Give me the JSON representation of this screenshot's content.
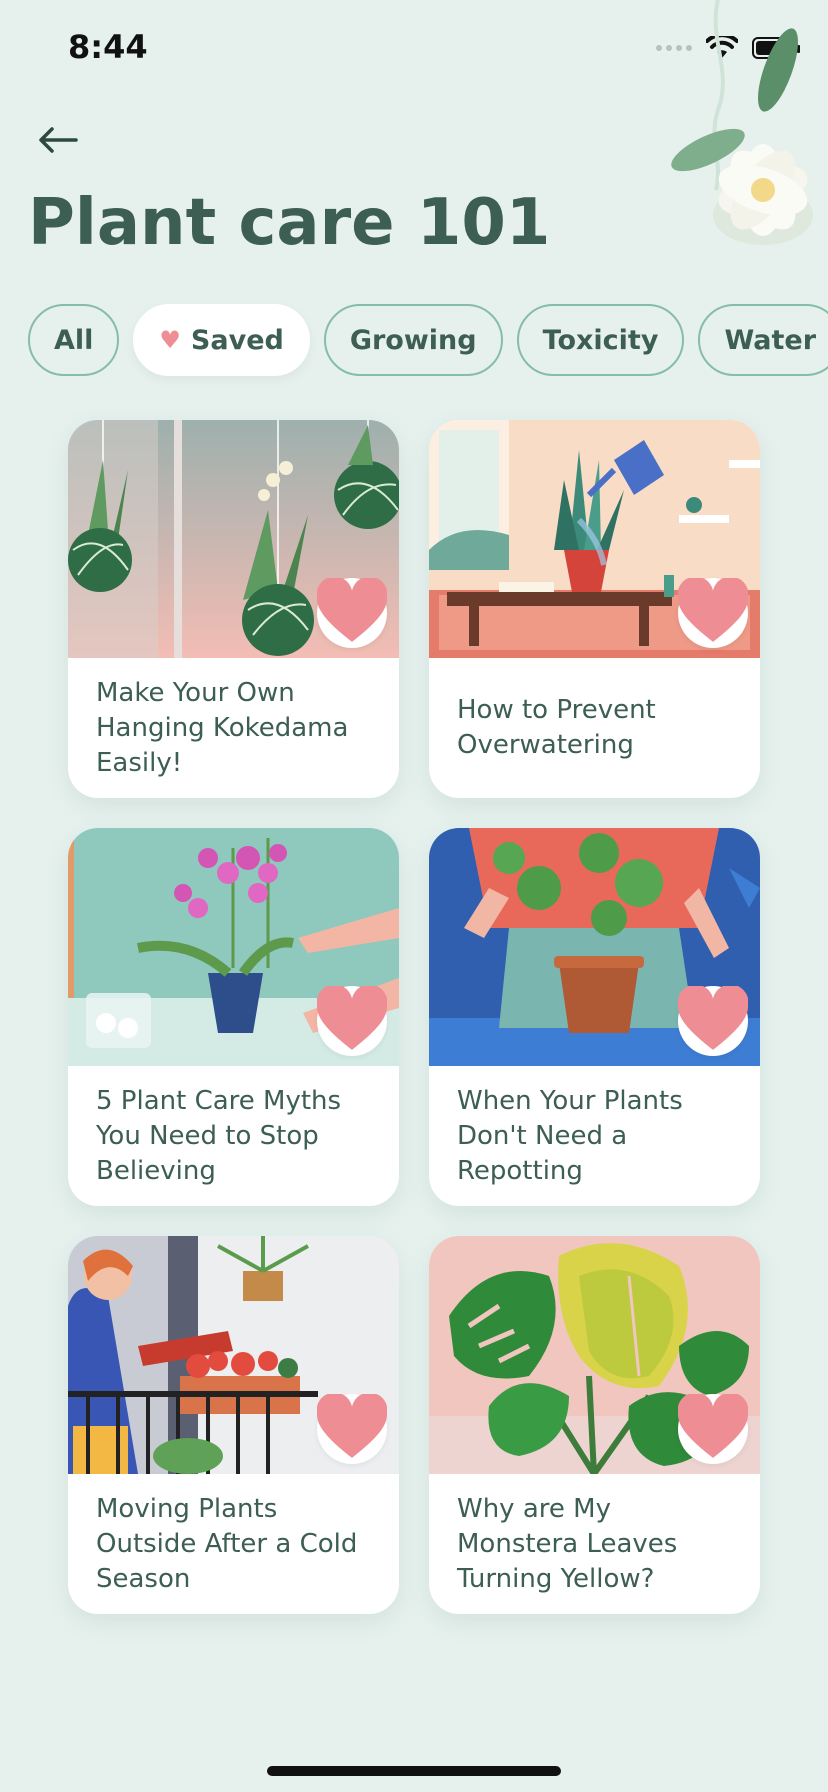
{
  "status": {
    "time": "8:44"
  },
  "header": {
    "title": "Plant care 101"
  },
  "filters": [
    {
      "label": "All",
      "active": false,
      "icon": null
    },
    {
      "label": "Saved",
      "active": true,
      "icon": "heart-icon"
    },
    {
      "label": "Growing",
      "active": false,
      "icon": null
    },
    {
      "label": "Toxicity",
      "active": false,
      "icon": null
    },
    {
      "label": "Water",
      "active": false,
      "icon": null
    }
  ],
  "articles": [
    {
      "title": "Make Your Own Hanging Kokedama Easily!",
      "saved": true
    },
    {
      "title": "How to Prevent Overwatering",
      "saved": true
    },
    {
      "title": "5 Plant Care Myths You Need to Stop Believing",
      "saved": true
    },
    {
      "title": "When Your Plants Don't Need a Repotting",
      "saved": true
    },
    {
      "title": "Moving Plants Outside After a Cold Season",
      "saved": true
    },
    {
      "title": "Why are My Monstera Leaves Turning Yellow?",
      "saved": true
    }
  ],
  "colors": {
    "accent": "#86bda7",
    "heart": "#ee8e94",
    "background": "#e6f1ee",
    "title": "#3d5e52"
  }
}
